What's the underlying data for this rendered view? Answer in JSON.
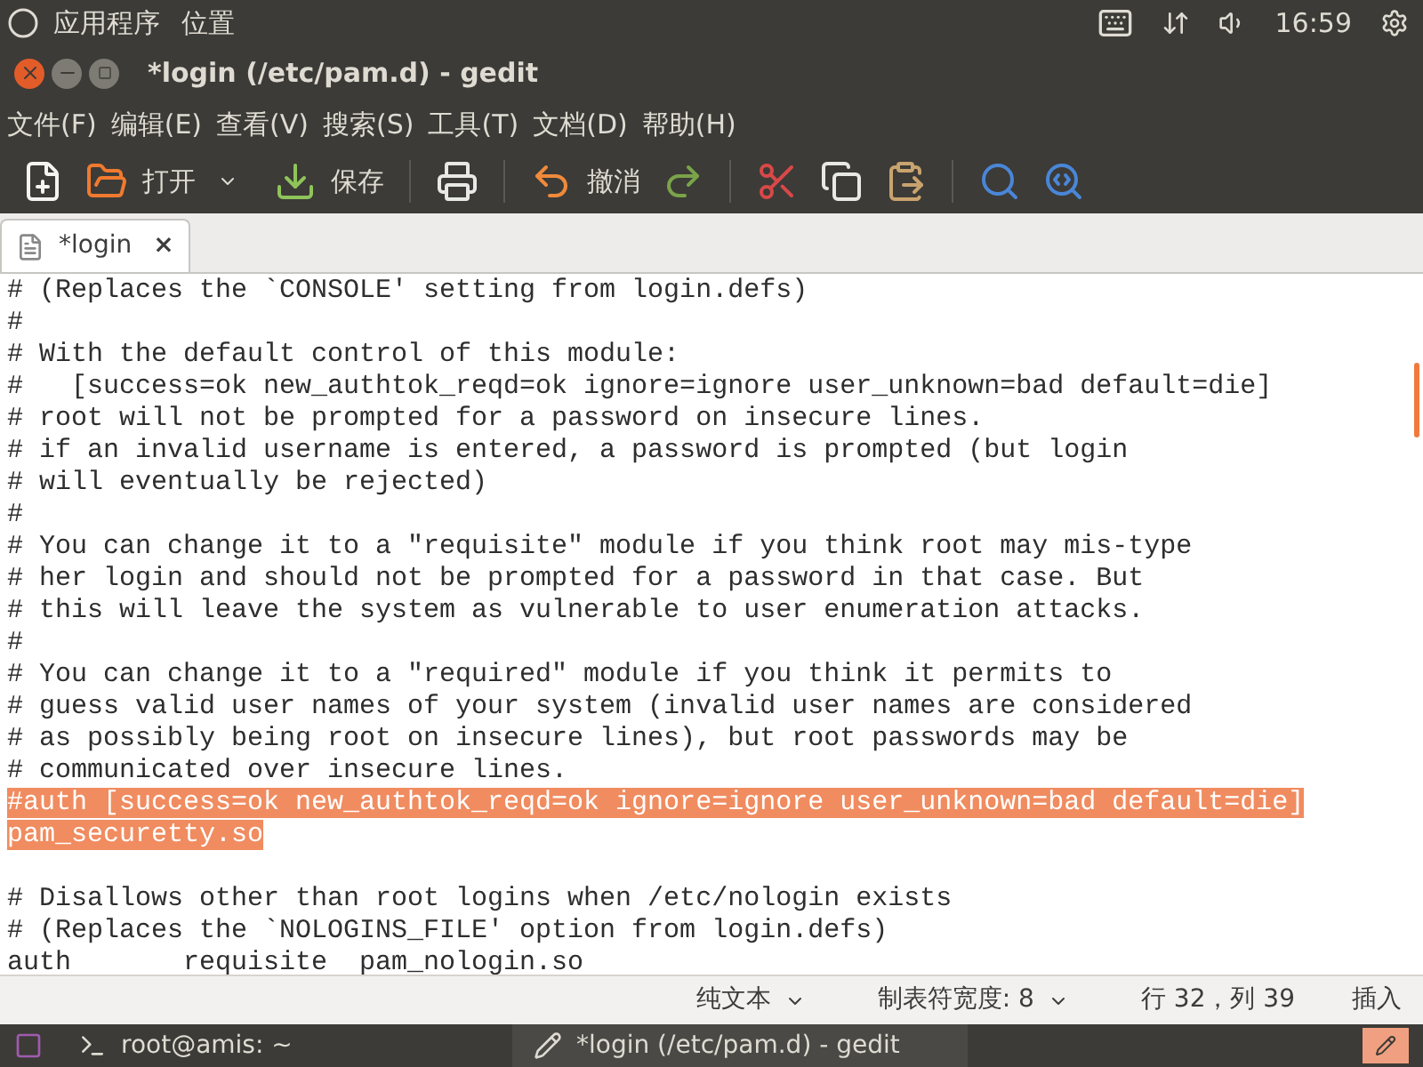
{
  "top_panel": {
    "menus": [
      "应用程序",
      "位置"
    ],
    "time": "16:59"
  },
  "window": {
    "title": "*login (/etc/pam.d) - gedit"
  },
  "menu_bar": [
    "文件(F)",
    "编辑(E)",
    "查看(V)",
    "搜索(S)",
    "工具(T)",
    "文档(D)",
    "帮助(H)"
  ],
  "toolbar": {
    "open_label": "打开",
    "save_label": "保存",
    "undo_label": "撤消"
  },
  "tabs": [
    {
      "label": "*login",
      "close": "×",
      "selected": true
    }
  ],
  "editor": {
    "lines": [
      {
        "text": "# (Replaces the `CONSOLE' setting from login.defs)",
        "selected": false
      },
      {
        "text": "#",
        "selected": false
      },
      {
        "text": "# With the default control of this module:",
        "selected": false
      },
      {
        "text": "#   [success=ok new_authtok_reqd=ok ignore=ignore user_unknown=bad default=die]",
        "selected": false
      },
      {
        "text": "# root will not be prompted for a password on insecure lines.",
        "selected": false
      },
      {
        "text": "# if an invalid username is entered, a password is prompted (but login",
        "selected": false
      },
      {
        "text": "# will eventually be rejected)",
        "selected": false
      },
      {
        "text": "#",
        "selected": false
      },
      {
        "text": "# You can change it to a \"requisite\" module if you think root may mis-type",
        "selected": false
      },
      {
        "text": "# her login and should not be prompted for a password in that case. But",
        "selected": false
      },
      {
        "text": "# this will leave the system as vulnerable to user enumeration attacks.",
        "selected": false
      },
      {
        "text": "#",
        "selected": false
      },
      {
        "text": "# You can change it to a \"required\" module if you think it permits to",
        "selected": false
      },
      {
        "text": "# guess valid user names of your system (invalid user names are considered",
        "selected": false
      },
      {
        "text": "# as possibly being root on insecure lines), but root passwords may be",
        "selected": false
      },
      {
        "text": "# communicated over insecure lines.",
        "selected": false
      },
      {
        "text": "#auth [success=ok new_authtok_reqd=ok ignore=ignore user_unknown=bad default=die]",
        "selected": true
      },
      {
        "text": "pam_securetty.so",
        "selected": true
      },
      {
        "text": "# Disallows other than root logins when /etc/nologin exists",
        "selected": false,
        "blank_line_before": true
      },
      {
        "text": "# (Replaces the `NOLOGINS_FILE' option from login.defs)",
        "selected": false
      },
      {
        "text": "auth       requisite  pam_nologin.so",
        "selected": false
      }
    ]
  },
  "status_bar": {
    "language": "纯文本",
    "tab_width": "制表符宽度: 8",
    "position": "行 32，列 39",
    "mode": "插入"
  },
  "taskbar": [
    {
      "label": "root@amis: ~",
      "selected": false
    },
    {
      "label": "*login (/etc/pam.d) - gedit",
      "selected": true
    }
  ]
}
